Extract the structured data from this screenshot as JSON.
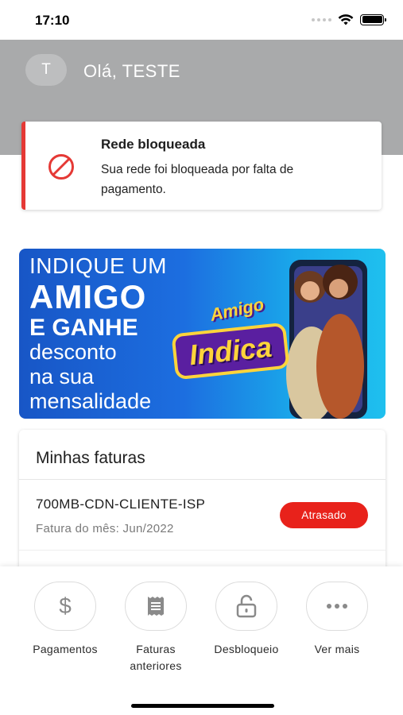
{
  "status_bar": {
    "time": "17:10"
  },
  "header": {
    "avatar_initial": "T",
    "greeting": "Olá, TESTE"
  },
  "alert": {
    "title": "Rede bloqueada",
    "message": "Sua rede foi bloqueada por falta de pagamento.",
    "accent_color": "#e53935"
  },
  "banner": {
    "line1": "INDIQUE UM",
    "line2": "AMIGO",
    "line3": "E GANHE",
    "line4": "desconto",
    "line5": "na sua",
    "line6": "mensalidade",
    "badge_top": "Amigo",
    "badge_main": "Indica"
  },
  "invoices": {
    "title": "Minhas faturas",
    "items": [
      {
        "name": "700MB-CDN-CLIENTE-ISP",
        "period": "Fatura do mês: Jun/2022",
        "status": "Atrasado",
        "status_color": "#e8221b"
      }
    ]
  },
  "actions": [
    {
      "label": "Pagamentos",
      "icon": "dollar-icon"
    },
    {
      "label": "Faturas anteriores",
      "icon": "receipt-icon"
    },
    {
      "label": "Desbloqueio",
      "icon": "lock-icon"
    },
    {
      "label": "Ver mais",
      "icon": "more-icon"
    }
  ]
}
